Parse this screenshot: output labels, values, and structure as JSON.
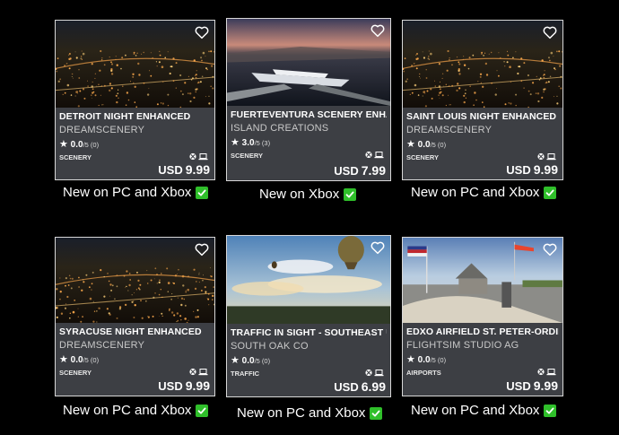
{
  "cards": [
    {
      "title": "DETROIT NIGHT ENHANCED",
      "publisher": "DREAMSCENERY",
      "rating": "0.0",
      "rating_suffix": "/5 (0)",
      "category": "SCENERY",
      "currency": "USD",
      "price": "9.99",
      "caption": "New on PC and Xbox",
      "thumb": "city-night"
    },
    {
      "title": "FUERTEVENTURA SCENERY ENHA",
      "publisher": "ISLAND CREATIONS",
      "rating": "3.0",
      "rating_suffix": "/5 (3)",
      "category": "SCENERY",
      "currency": "USD",
      "price": "7.99",
      "caption": "New on Xbox",
      "thumb": "cruise-port"
    },
    {
      "title": "SAINT LOUIS NIGHT ENHANCED",
      "publisher": "DREAMSCENERY",
      "rating": "0.0",
      "rating_suffix": "/5 (0)",
      "category": "SCENERY",
      "currency": "USD",
      "price": "9.99",
      "caption": "New on PC and Xbox",
      "thumb": "city-night"
    },
    {
      "title": "SYRACUSE NIGHT ENHANCED",
      "publisher": "DREAMSCENERY",
      "rating": "0.0",
      "rating_suffix": "/5 (0)",
      "category": "SCENERY",
      "currency": "USD",
      "price": "9.99",
      "caption": "New on PC and Xbox",
      "thumb": "city-night-2"
    },
    {
      "title": "TRAFFIC IN SIGHT - SOUTHEAST U",
      "publisher": "SOUTH OAK CO",
      "rating": "0.0",
      "rating_suffix": "/5 (0)",
      "category": "TRAFFIC",
      "currency": "USD",
      "price": "6.99",
      "caption": "New on PC and Xbox",
      "thumb": "sky-balloon"
    },
    {
      "title": "EDXO AIRFIELD ST. PETER-ORDING",
      "publisher": "FLIGHTSIM STUDIO AG",
      "rating": "0.0",
      "rating_suffix": "/5 (0)",
      "category": "AIRPORTS",
      "currency": "USD",
      "price": "9.99",
      "caption": "New on PC and Xbox",
      "thumb": "airfield"
    }
  ],
  "icons": {
    "favorite": "heart-icon",
    "xbox": "xbox-icon",
    "pc": "laptop-icon",
    "new": "checkmark-icon"
  },
  "colors": {
    "card_bg": "#3d3f44",
    "check_green": "#2fbf2a"
  }
}
